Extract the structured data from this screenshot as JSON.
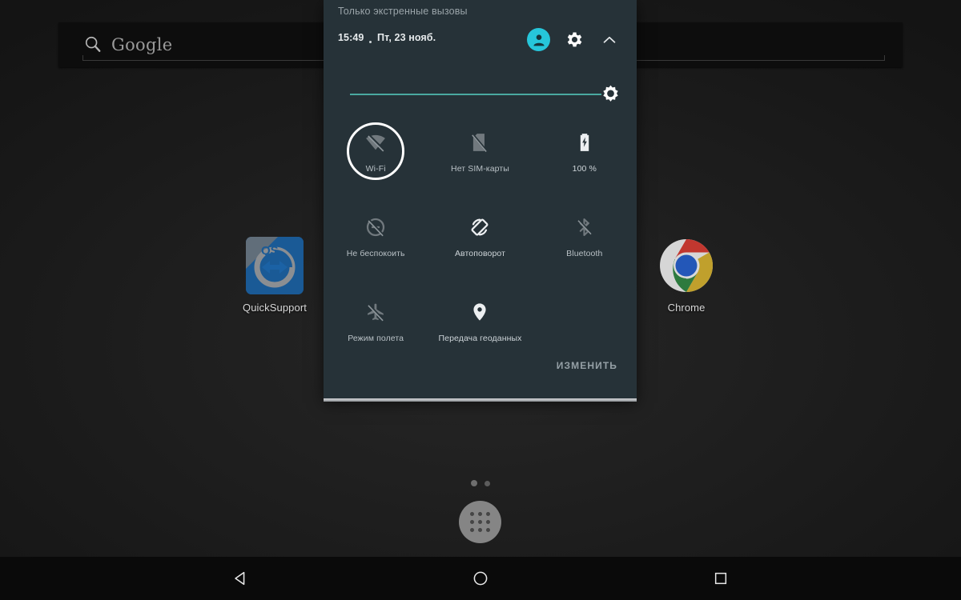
{
  "home": {
    "search": {
      "label": "Google",
      "icon": "search-icon"
    },
    "apps": [
      {
        "label": "QuickSupport",
        "icon": "teamviewer-quicksupport-icon"
      },
      {
        "label": "Chrome",
        "icon": "chrome-icon"
      }
    ],
    "page_indicator": {
      "total": 2,
      "active": 1
    },
    "drawer": {
      "icon": "apps-grid-icon"
    }
  },
  "nav_bar": {
    "back": {
      "label": "Назад",
      "icon": "back-triangle-icon"
    },
    "home": {
      "label": "Главный экран",
      "icon": "home-circle-icon"
    },
    "recents": {
      "label": "Обзор",
      "icon": "recents-square-icon"
    }
  },
  "quick_settings": {
    "carrier_status": "Только экстренные вызовы",
    "time": "15:49",
    "date": "Пт, 23 нояб.",
    "avatar": {
      "icon": "user-avatar-icon",
      "color": "#26c6da"
    },
    "settings": {
      "icon": "gear-icon"
    },
    "collapse": {
      "icon": "chevron-up-icon"
    },
    "brightness": {
      "icon": "brightness-sun-icon",
      "value": 100,
      "track_color": "#4aa9a0"
    },
    "tiles": [
      {
        "label": "Wi-Fi",
        "icon": "wifi-off-icon",
        "state": "off",
        "highlighted": true
      },
      {
        "label": "Нет SIM-карты",
        "icon": "sim-card-off-icon",
        "state": "off",
        "highlighted": false
      },
      {
        "label": "100 %",
        "icon": "battery-charging-icon",
        "state": "on",
        "highlighted": false
      },
      {
        "label": "Не беспокоить",
        "icon": "do-not-disturb-off-icon",
        "state": "off",
        "highlighted": false
      },
      {
        "label": "Автоповорот",
        "icon": "auto-rotate-icon",
        "state": "on",
        "highlighted": false
      },
      {
        "label": "Bluetooth",
        "icon": "bluetooth-off-icon",
        "state": "off",
        "highlighted": false
      },
      {
        "label": "Режим полета",
        "icon": "airplane-mode-off-icon",
        "state": "off",
        "highlighted": false
      },
      {
        "label": "Передача геоданных",
        "icon": "location-on-icon",
        "state": "on",
        "highlighted": false
      }
    ],
    "edit_label": "ИЗМЕНИТЬ",
    "panel_color": "#263238"
  }
}
